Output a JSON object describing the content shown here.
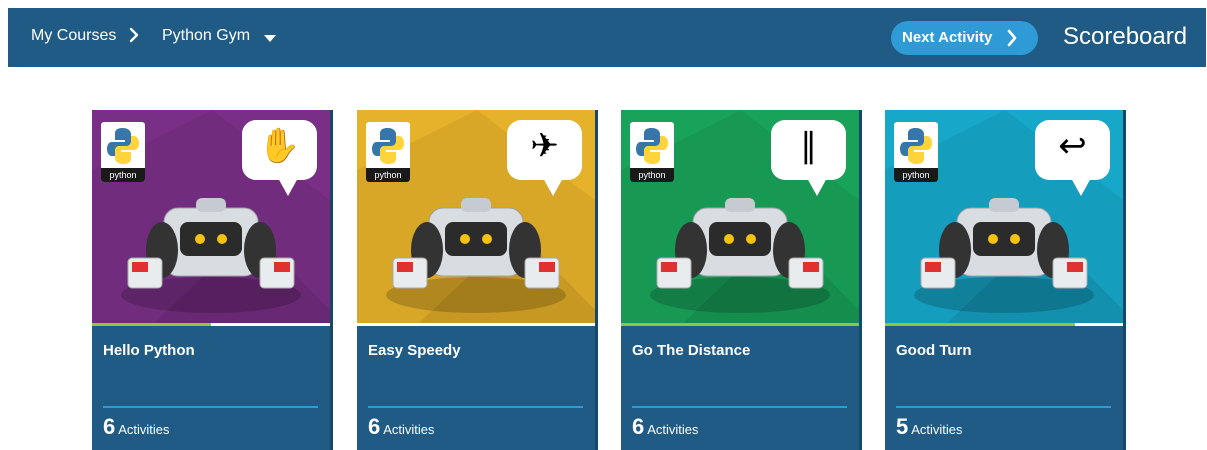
{
  "header": {
    "breadcrumb_my_courses": "My Courses",
    "breadcrumb_course": "Python Gym",
    "next_activity_label": "Next Activity",
    "scoreboard_label": "Scoreboard"
  },
  "colors": {
    "topbar": "#1f5b85",
    "button": "#2f9bd6",
    "progress": "#8dc63f"
  },
  "cards": [
    {
      "title": "Hello Python",
      "count": "6",
      "count_label": "Activities",
      "logo_text": "python",
      "bubble_icon": "waving-hand-icon",
      "bg": "#7a2f86",
      "progress": 0.5
    },
    {
      "title": "Easy Speedy",
      "count": "6",
      "count_label": "Activities",
      "logo_text": "python",
      "bubble_icon": "rocket-icon",
      "bg": "#e6b22a",
      "progress": 0
    },
    {
      "title": "Go The Distance",
      "count": "6",
      "count_label": "Activities",
      "logo_text": "python",
      "bubble_icon": "ruler-icon",
      "bg": "#19a35a",
      "progress": 1
    },
    {
      "title": "Good Turn",
      "count": "5",
      "count_label": "Activities",
      "logo_text": "python",
      "bubble_icon": "return-arrow-icon",
      "bg": "#16a7c9",
      "progress": 0.8
    }
  ]
}
